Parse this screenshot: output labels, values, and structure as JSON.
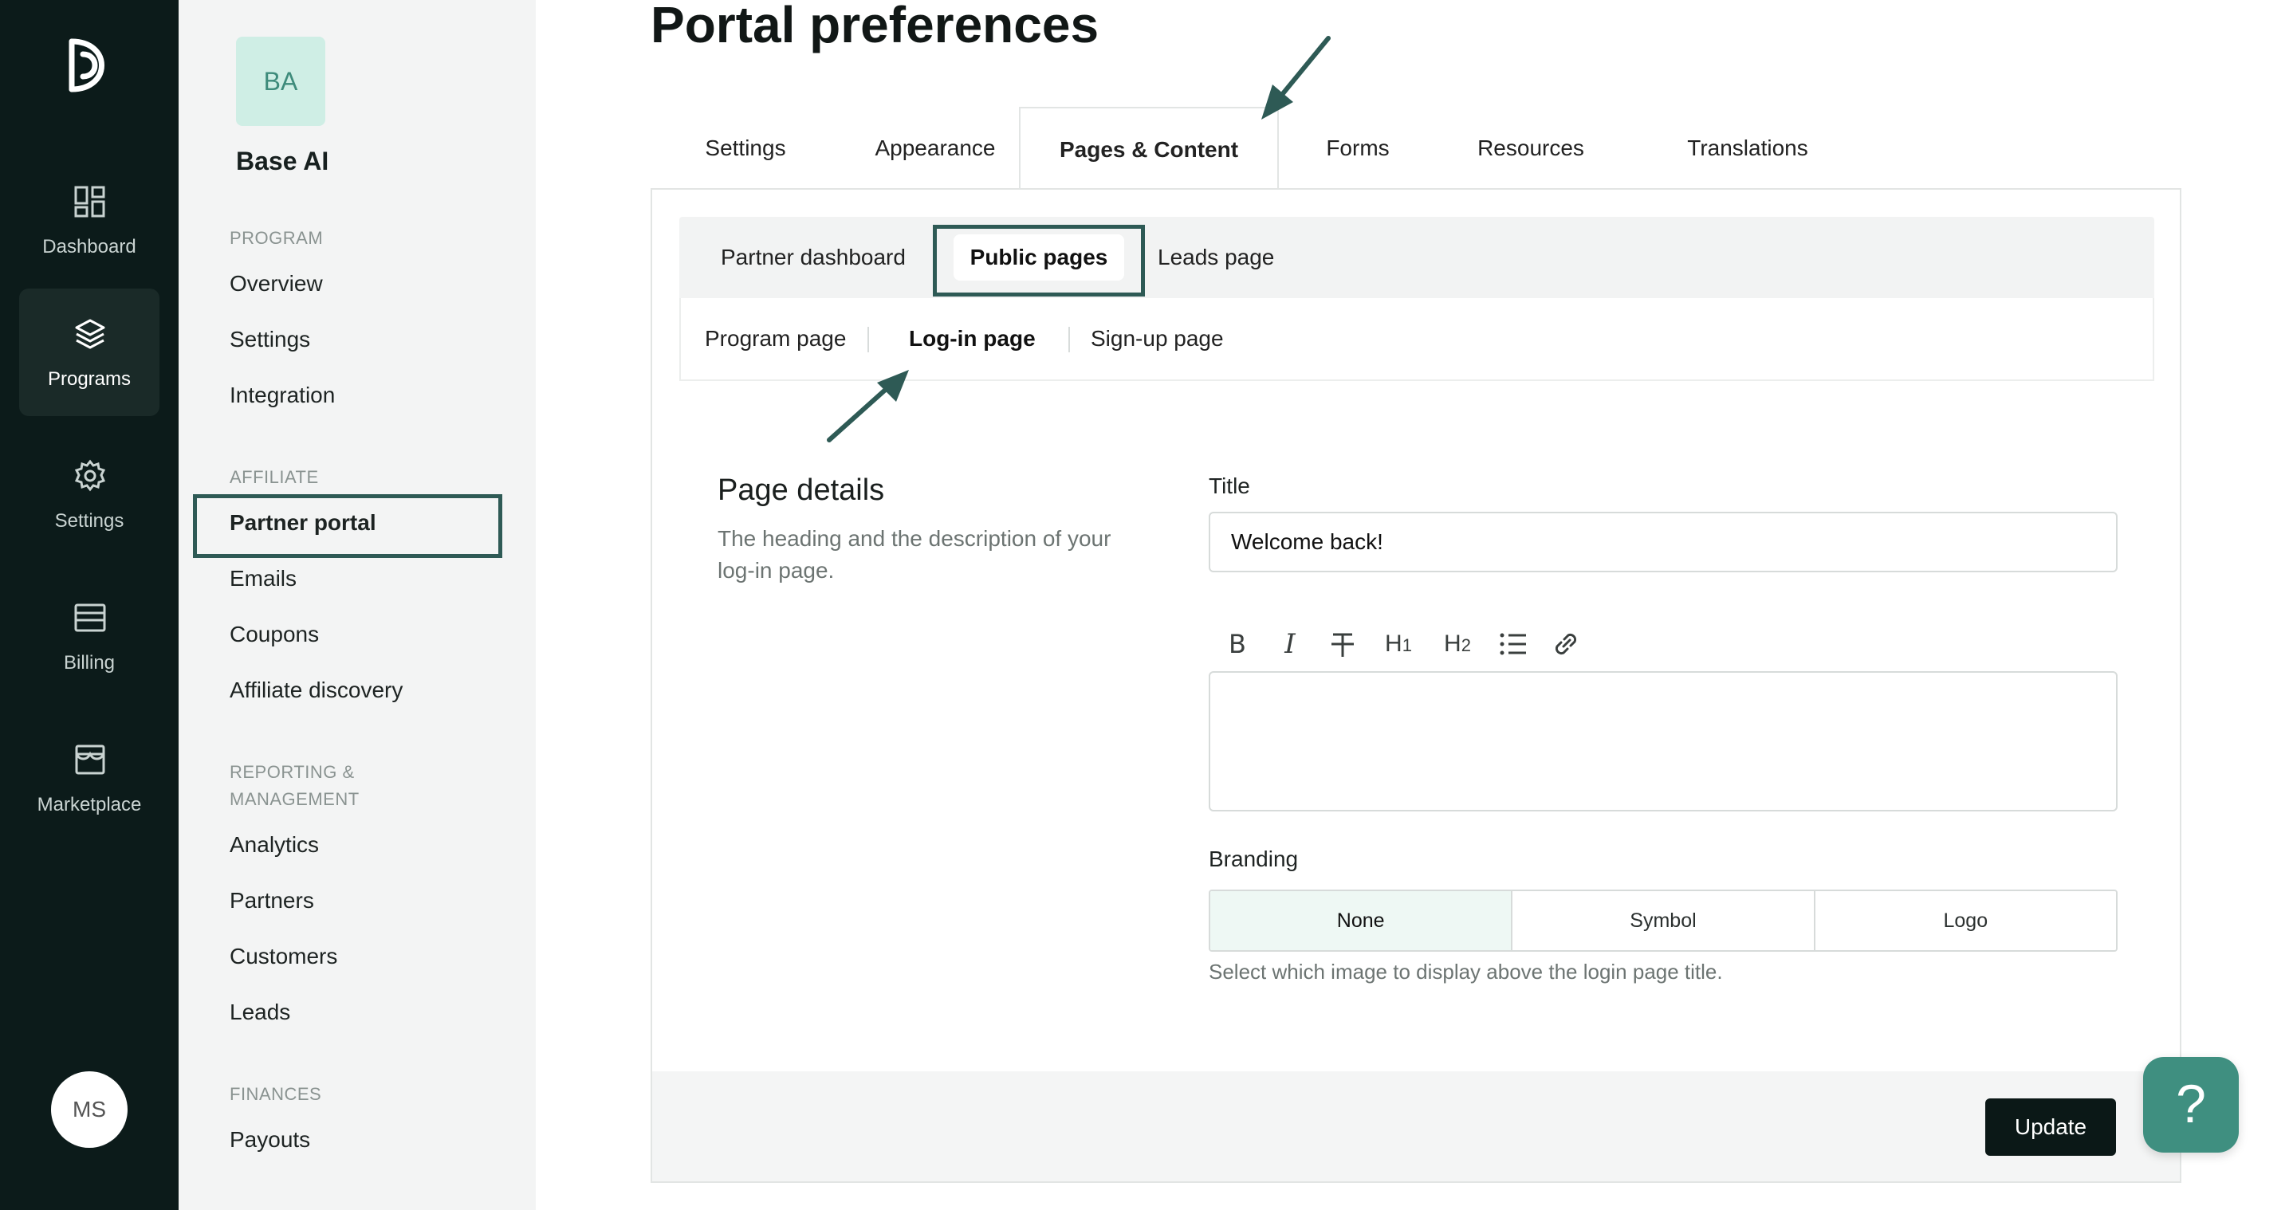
{
  "rail": {
    "items": [
      {
        "label": "Dashboard",
        "icon": "dashboard-icon"
      },
      {
        "label": "Programs",
        "icon": "layers-icon",
        "active": true
      },
      {
        "label": "Settings",
        "icon": "gear-icon"
      },
      {
        "label": "Billing",
        "icon": "billing-icon"
      },
      {
        "label": "Marketplace",
        "icon": "store-icon"
      }
    ],
    "avatar_initials": "MS"
  },
  "sidebar": {
    "org_initials": "BA",
    "org_name": "Base AI",
    "sections": [
      {
        "heading": "PROGRAM",
        "items": [
          "Overview",
          "Settings",
          "Integration"
        ]
      },
      {
        "heading": "AFFILIATE",
        "items": [
          "Partner portal",
          "Emails",
          "Coupons",
          "Affiliate discovery"
        ],
        "active_item": "Partner portal"
      },
      {
        "heading": "REPORTING & MANAGEMENT",
        "items": [
          "Analytics",
          "Partners",
          "Customers",
          "Leads"
        ]
      },
      {
        "heading": "FINANCES",
        "items": [
          "Payouts"
        ]
      }
    ]
  },
  "main": {
    "title": "Portal preferences",
    "tabs": [
      "Settings",
      "Appearance",
      "Pages & Content",
      "Forms",
      "Resources",
      "Translations"
    ],
    "active_tab": "Pages & Content",
    "subtabs": [
      "Partner dashboard",
      "Public pages",
      "Leads page"
    ],
    "active_subtab": "Public pages",
    "pagetabs": [
      "Program page",
      "Log-in page",
      "Sign-up page"
    ],
    "active_pagetab": "Log-in page",
    "section_title": "Page details",
    "section_desc": "The heading and the description of your log-in page.",
    "title_label": "Title",
    "title_value": "Welcome back!",
    "toolbar": [
      "B",
      "I",
      "S",
      "H1",
      "H2",
      "list",
      "link"
    ],
    "branding_label": "Branding",
    "branding_options": [
      "None",
      "Symbol",
      "Logo"
    ],
    "branding_selected": "None",
    "branding_hint": "Select which image to display above the login page title.",
    "update_label": "Update"
  },
  "colors": {
    "rail_bg": "#0c1b1a",
    "accent": "#2e5a55",
    "help_button": "#3f8f80",
    "primary_button": "#0b1817"
  }
}
